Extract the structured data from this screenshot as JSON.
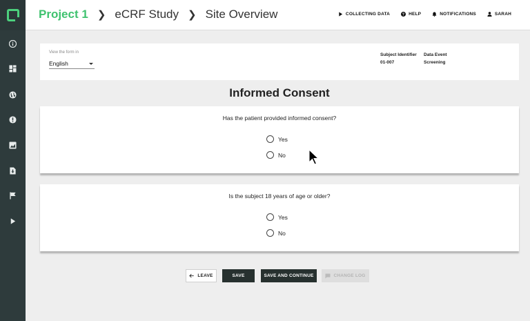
{
  "sidebar": {
    "icons": [
      "info-icon",
      "dashboard-icon",
      "globe-icon",
      "alert-icon",
      "chart-icon",
      "document-download-icon",
      "flag-icon",
      "play-icon"
    ]
  },
  "header": {
    "breadcrumbs": [
      "Project 1",
      "eCRF Study",
      "Site Overview"
    ],
    "nav": {
      "collecting": "COLLECTING DATA",
      "help": "HELP",
      "notifications": "NOTIFICATIONS",
      "user": "SARAH"
    }
  },
  "info": {
    "language_label": "View the form in",
    "language_value": "English",
    "subject_label": "Subject Identifier",
    "subject_value": "01-007",
    "event_label": "Data Event",
    "event_value": "Screening"
  },
  "form": {
    "title": "Informed Consent",
    "questions": [
      {
        "text": "Has the patient provided informed consent?",
        "options": [
          "Yes",
          "No"
        ]
      },
      {
        "text": "Is the subject 18 years of age or older?",
        "options": [
          "Yes",
          "No"
        ]
      }
    ]
  },
  "actions": {
    "leave": "LEAVE",
    "save": "SAVE",
    "save_continue": "SAVE AND CONTINUE",
    "change_log": "CHANGE LOG"
  },
  "colors": {
    "brand_green": "#3fc26f",
    "sidebar_bg": "#2e3b3c",
    "button_dark": "#27312f"
  }
}
